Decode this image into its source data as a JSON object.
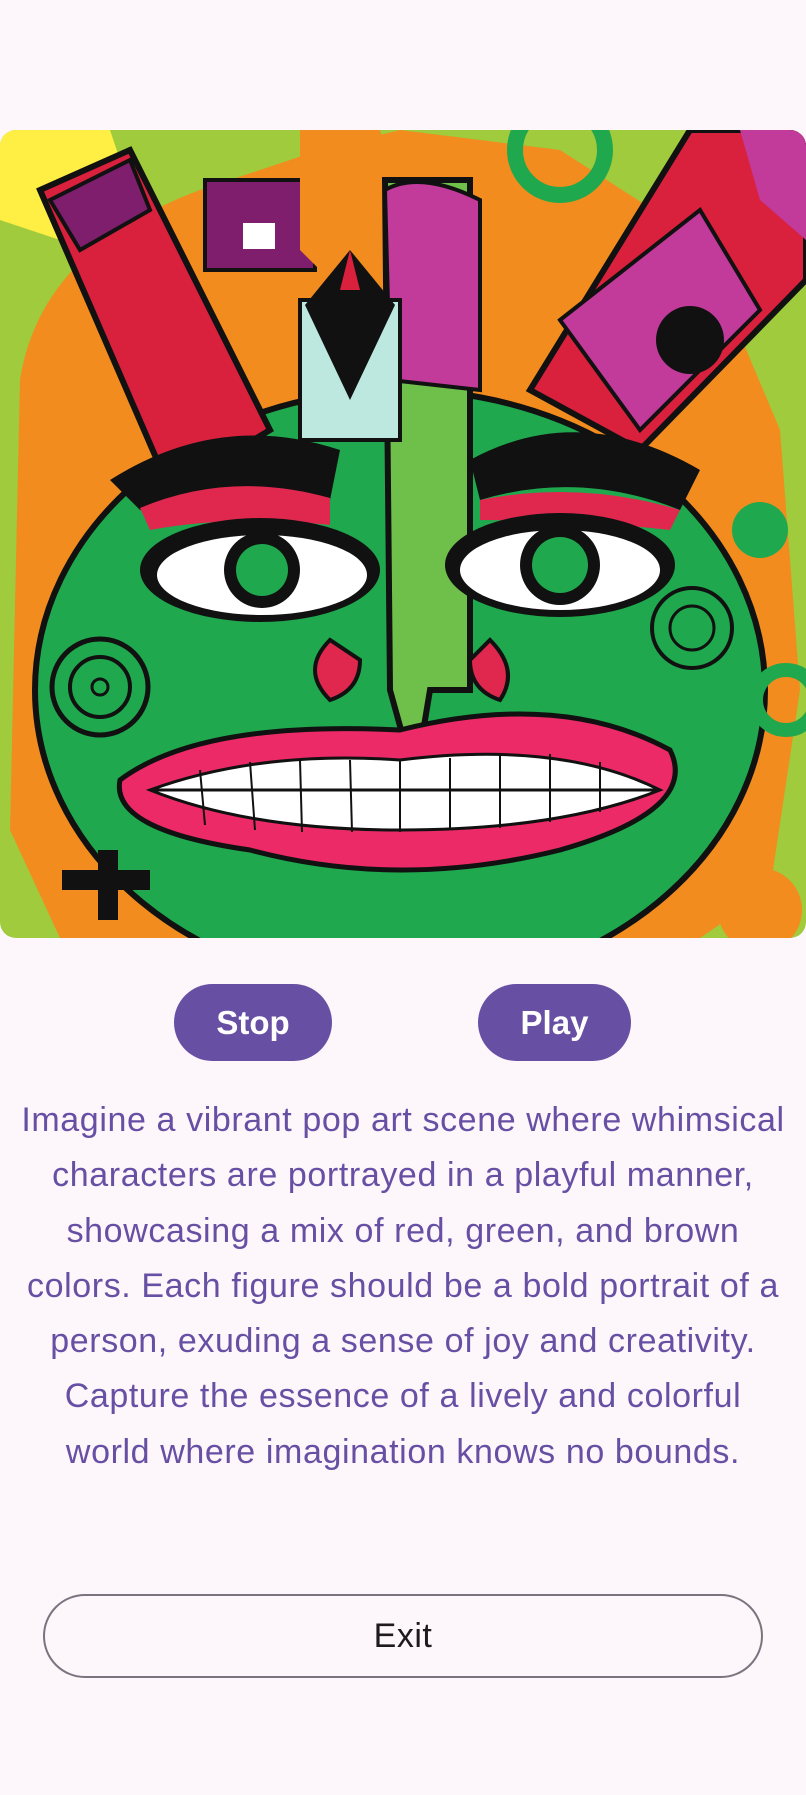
{
  "buttons": {
    "stop_label": "Stop",
    "play_label": "Play",
    "exit_label": "Exit"
  },
  "description": "Imagine a vibrant pop art scene where whimsical characters are portrayed in a playful manner, showcasing a mix of red, green, and brown colors. Each figure should be a bold portrait of a person, exuding a sense of joy and creativity. Capture the essence of a lively and colorful world where imagination knows no bounds.",
  "colors": {
    "background": "#fdf6fb",
    "primary": "#6750a4",
    "on_primary": "#ffffff",
    "outline": "#79747e"
  }
}
